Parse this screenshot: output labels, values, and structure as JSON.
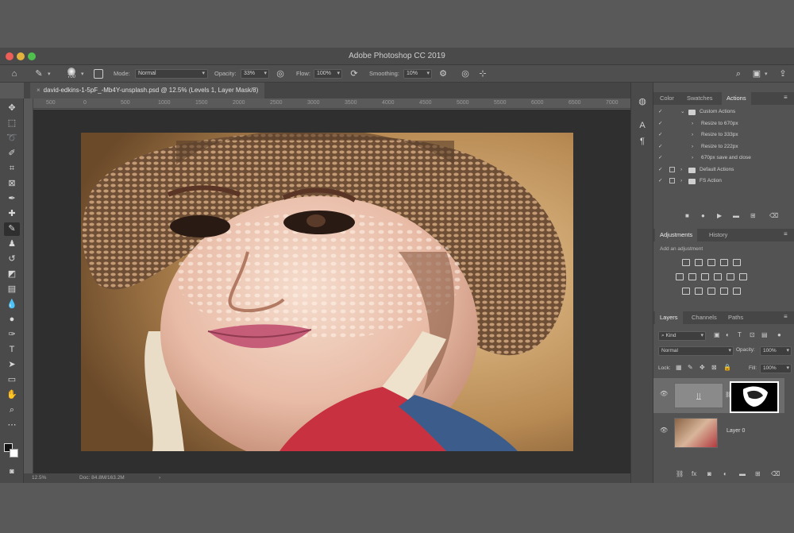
{
  "window": {
    "title": "Adobe Photoshop CC 2019"
  },
  "options_bar": {
    "brush_size": "700",
    "mode_label": "Mode:",
    "mode_value": "Normal",
    "opacity_label": "Opacity:",
    "opacity_value": "33%",
    "flow_label": "Flow:",
    "flow_value": "100%",
    "smoothing_label": "Smoothing:",
    "smoothing_value": "10%"
  },
  "document": {
    "tab_title": "david-edkins-1-5pF_-Mb4Y-unsplash.psd @ 12.5% (Levels 1, Layer Mask/8)",
    "ruler_h": [
      "500",
      "0",
      "500",
      "1000",
      "1500",
      "2000",
      "2500",
      "3000",
      "3500",
      "4000",
      "4500",
      "5000",
      "5500",
      "6000",
      "6500",
      "7000"
    ],
    "zoom": "12.5%",
    "doc_info": "Doc: 84.8M/163.2M",
    "status_arrow": "›"
  },
  "panel_tabs_top": [
    "Color",
    "Swatches",
    "Actions"
  ],
  "actions": {
    "items": [
      {
        "label": "Custom Actions",
        "indent": 0,
        "folder": true,
        "expanded": true
      },
      {
        "label": "Resize to 670px",
        "indent": 1,
        "folder": false
      },
      {
        "label": "Resize to 333px",
        "indent": 1,
        "folder": false
      },
      {
        "label": "Resize to 222px",
        "indent": 1,
        "folder": false
      },
      {
        "label": "670px save and close",
        "indent": 1,
        "folder": false
      },
      {
        "label": "Default Actions",
        "indent": 0,
        "folder": true,
        "expanded": false
      },
      {
        "label": "FS Action",
        "indent": 0,
        "folder": true,
        "expanded": false
      }
    ]
  },
  "panel_tabs_mid": [
    "Adjustments",
    "History"
  ],
  "adjustments": {
    "hint": "Add an adjustment"
  },
  "panel_tabs_layers": [
    "Layers",
    "Channels",
    "Paths"
  ],
  "layers_panel": {
    "kind_label": "Kind",
    "blend_mode": "Normal",
    "opacity_label": "Opacity:",
    "opacity_value": "100%",
    "lock_label": "Lock:",
    "fill_label": "Fill:",
    "fill_value": "100%",
    "layers": [
      {
        "name": ""
      },
      {
        "name": "Layer 0"
      }
    ]
  },
  "colors": {
    "accent": "#2e6fd1",
    "panel": "#535353",
    "canvas": "#2f2f2f"
  }
}
